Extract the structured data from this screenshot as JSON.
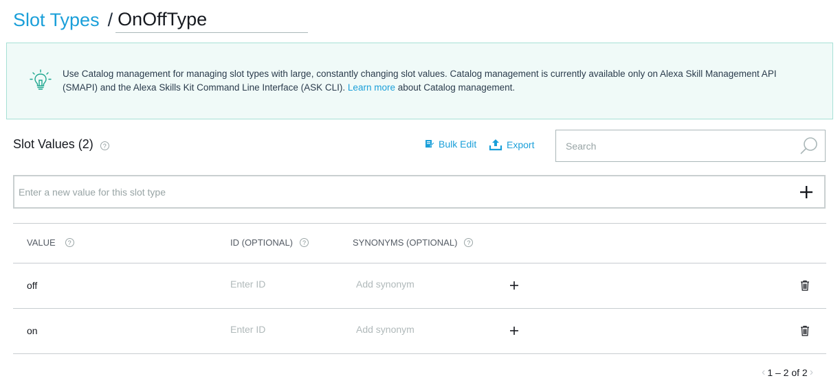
{
  "header": {
    "breadcrumb_link": "Slot Types",
    "separator": "/",
    "slot_type_name": "OnOffType"
  },
  "banner": {
    "text_before": "Use Catalog management for managing slot types with large, constantly changing slot values. Catalog management is currently available only on Alexa Skill Management API (SMAPI) and the Alexa Skills Kit Command Line Interface (ASK CLI). ",
    "link_text": "Learn more",
    "text_after": " about Catalog management.",
    "icon": "lightbulb-icon"
  },
  "slot_values": {
    "title": "Slot Values (2)",
    "help": "?",
    "bulk_edit_label": "Bulk Edit",
    "export_label": "Export",
    "search_placeholder": "Search",
    "new_value_placeholder": "Enter a new value for this slot type"
  },
  "table": {
    "columns": [
      {
        "label": "VALUE",
        "help": "?"
      },
      {
        "label": "ID (OPTIONAL)",
        "help": "?"
      },
      {
        "label": "SYNONYMS (OPTIONAL)",
        "help": "?"
      }
    ],
    "rows": [
      {
        "value": "off",
        "id_placeholder": "Enter ID",
        "synonym_placeholder": "Add synonym"
      },
      {
        "value": "on",
        "id_placeholder": "Enter ID",
        "synonym_placeholder": "Add synonym"
      }
    ]
  },
  "pagination": {
    "label": "1 – 2 of 2",
    "prev": "‹",
    "next": "›"
  },
  "colors": {
    "accent": "#1a9fd9",
    "banner_bg": "#f0faf8",
    "banner_border": "#a6e0d5",
    "icon_teal": "#1ca68e"
  }
}
